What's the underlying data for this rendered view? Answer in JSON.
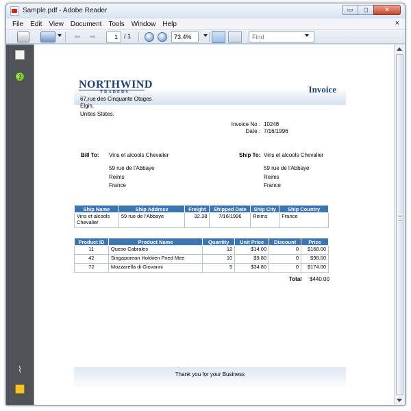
{
  "window": {
    "title": "Sample.pdf - Adobe Reader",
    "buttons": {
      "minimize": "▭",
      "maximize": "◻",
      "close": "✕"
    }
  },
  "menu": [
    "File",
    "Edit",
    "View",
    "Document",
    "Tools",
    "Window",
    "Help"
  ],
  "menu_close": "×",
  "toolbar": {
    "page_current": "1",
    "page_total": "/ 1",
    "zoom": "73.4%",
    "find_placeholder": "Find"
  },
  "icons": {
    "left_pane": [
      "pages-icon",
      "help-icon",
      "attachment-icon",
      "comment-icon"
    ],
    "toolbar": [
      "printer-icon",
      "share-icon",
      "prev-page-icon",
      "next-page-icon",
      "zoom-out-icon",
      "zoom-in-icon",
      "single-page-icon",
      "fit-page-icon"
    ]
  },
  "invoice": {
    "logo_main": "NORTHWIND",
    "logo_sub": "TRADERS",
    "title": "Invoice",
    "company_address": [
      "67,rue des Cinquante Otages",
      "Elgin,",
      "Unites States."
    ],
    "invoice_no_label": "Invoice No :",
    "invoice_no": "10248",
    "date_label": "Date :",
    "date": "7/16/1996",
    "bill_to_label": "Bill To:",
    "bill_to": [
      "Vins et alcools Chevalier",
      "59 rue de l'Abbaye",
      "Reims",
      "France"
    ],
    "ship_to_label": "Ship To:",
    "ship_to": [
      "Vins et alcools Chevalier",
      "59 rue de l'Abbaye",
      "Reims",
      "France"
    ],
    "ship_table": {
      "headers": [
        "Ship Name",
        "Ship Address",
        "Freight",
        "Shipped Date",
        "Ship City",
        "Ship Country"
      ],
      "row": [
        "Vins et alcools Chevalier",
        "59 rue de l'Abbaye",
        "32.38",
        "7/16/1996",
        "Reims",
        "France"
      ]
    },
    "product_table": {
      "headers": [
        "Product ID",
        "Product Name",
        "Quantity",
        "Unit Price",
        "Discount",
        "Price"
      ],
      "rows": [
        [
          "11",
          "Queso Cabrales",
          "12",
          "$14.00",
          "0",
          "$168.00"
        ],
        [
          "42",
          "Singaporean Hokkien Fried Mee",
          "10",
          "$9.80",
          "0",
          "$98.00"
        ],
        [
          "72",
          "Mozzarella di Giovanni",
          "5",
          "$34.80",
          "0",
          "$174.00"
        ]
      ]
    },
    "total_label": "Total",
    "total": "$440.00",
    "footer": "Thank you for your Business"
  }
}
